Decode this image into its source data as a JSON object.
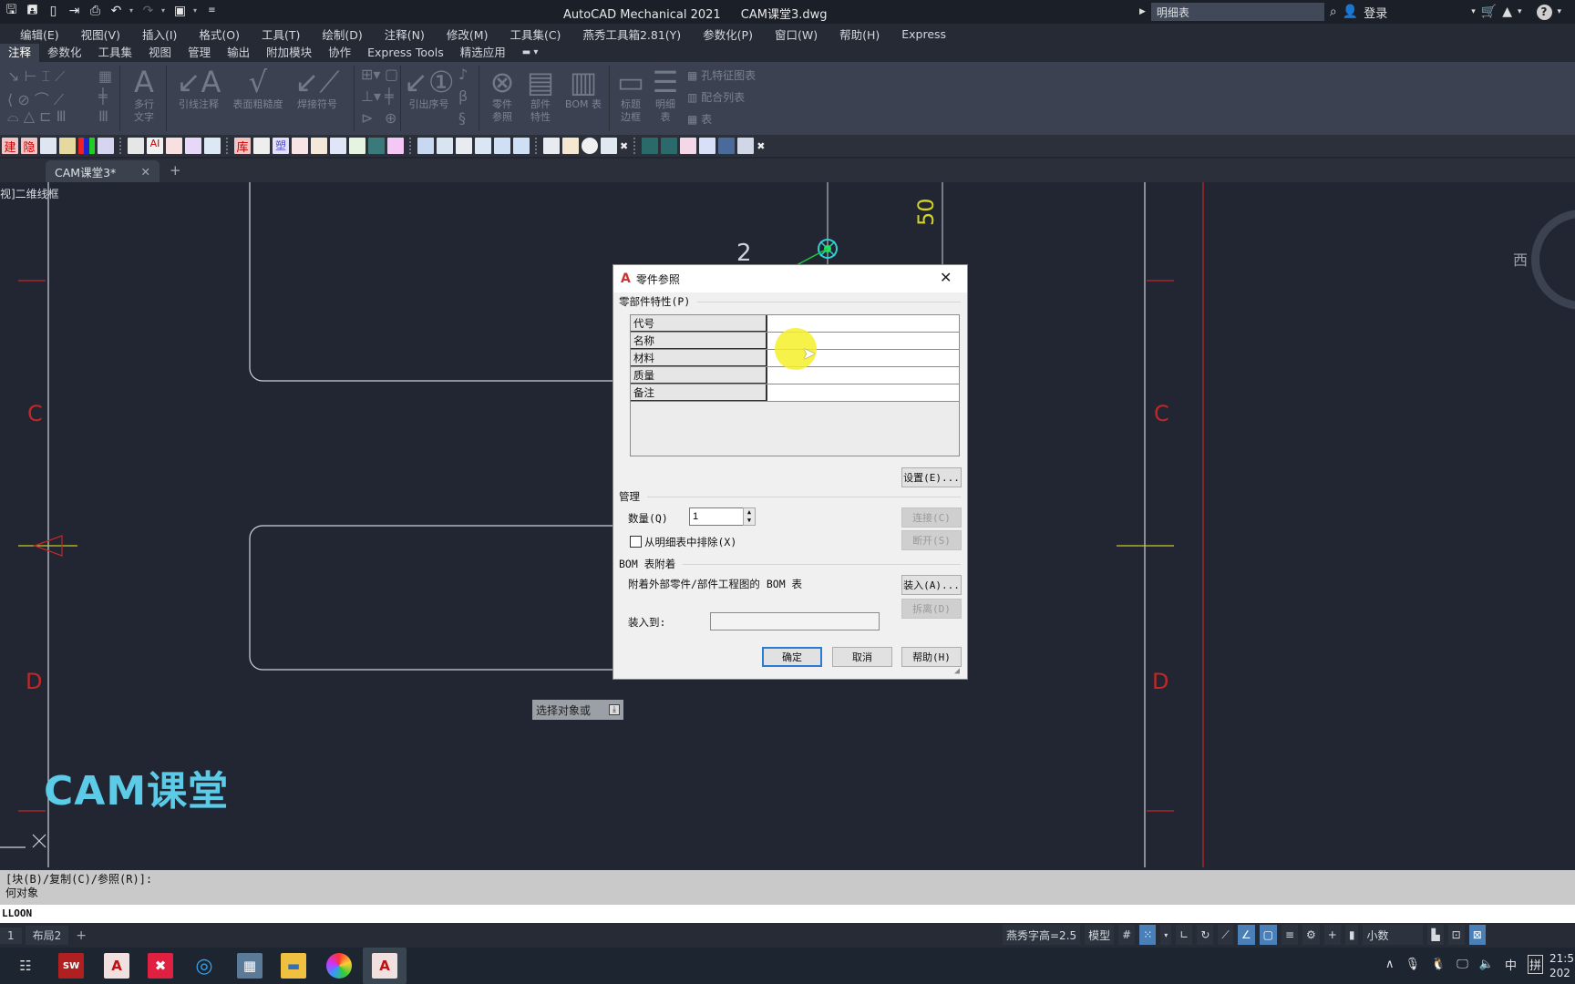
{
  "titlebar": {
    "app_name": "AutoCAD Mechanical 2021",
    "file_name": "CAM课堂3.dwg",
    "search_value": "明细表",
    "login_label": "登录"
  },
  "quick_access": [
    "save-icon",
    "save-as-icon",
    "open-icon",
    "export-icon",
    "print-icon",
    "undo-icon",
    "redo-icon",
    "workspace-icon",
    "customize-icon"
  ],
  "menubar": [
    "编辑(E)",
    "视图(V)",
    "插入(I)",
    "格式(O)",
    "工具(T)",
    "绘制(D)",
    "注释(N)",
    "修改(M)",
    "工具集(C)",
    "燕秀工具箱2.81(Y)",
    "参数化(P)",
    "窗口(W)",
    "帮助(H)",
    "Express"
  ],
  "ribbon_tabs": [
    "注释",
    "参数化",
    "工具集",
    "视图",
    "管理",
    "输出",
    "附加模块",
    "协作",
    "Express Tools",
    "精选应用"
  ],
  "ribbon": {
    "multiline_text": "多行\n文字",
    "leader_note": "引线注释",
    "surface_roughness": "表面粗糙度",
    "weld_symbol": "焊接符号",
    "balloon": "引出序号",
    "part_reference": "零件\n参照",
    "part_properties": "部件\n特性",
    "bom_table": "BOM 表",
    "title_border": "标题\n边框",
    "parts_list": "明细\n表",
    "hole_chart": "孔特征图表",
    "fits_list": "配合列表",
    "table": "表"
  },
  "doc_tab": {
    "label": "CAM课堂3*"
  },
  "canvas": {
    "view_label": "视]二维线框",
    "watermark": "CAM课堂",
    "dim_text": "50",
    "balloon_text": "2",
    "border_letters": [
      "C",
      "C",
      "D",
      "D"
    ],
    "prompt_tooltip": "选择对象或",
    "viewcube_west": "西"
  },
  "dialog": {
    "title": "零件参照",
    "props_group": "零部件特性(P)",
    "props": [
      {
        "key": "代号",
        "value": ""
      },
      {
        "key": "名称",
        "value": ""
      },
      {
        "key": "材料",
        "value": ""
      },
      {
        "key": "质量",
        "value": ""
      },
      {
        "key": "备注",
        "value": ""
      }
    ],
    "settings_btn": "设置(E)...",
    "manage_group": "管理",
    "qty_label": "数量(Q)",
    "qty_value": "1",
    "connect_btn": "连接(C)",
    "disconnect_btn": "断开(S)",
    "exclude_label": "从明细表中排除(X)",
    "exclude_checked": false,
    "bom_group": "BOM 表附着",
    "bom_desc": "附着外部零件/部件工程图的 BOM 表",
    "load_btn": "装入(A)...",
    "detach_btn": "拆离(D)",
    "load_into_label": "装入到:",
    "load_into_value": "",
    "ok_btn": "确定",
    "cancel_btn": "取消",
    "help_btn": "帮助(H)"
  },
  "commandline": {
    "history1": "[块(B)/复制(C)/参照(R)]:",
    "history2": "何对象",
    "input": "LLOON"
  },
  "layout_tabs": [
    "1",
    "布局2"
  ],
  "statusbar": {
    "text_height": "燕秀字高=2.5",
    "model": "模型",
    "units": "小数"
  },
  "taskbar": {
    "apps": [
      "task-view",
      "solidworks-2021",
      "autocad",
      "xmind",
      "browser",
      "calculator",
      "file-explorer",
      "color-app",
      "autocad-mechanical"
    ],
    "tray_ime": "中",
    "tray_pinyin": "拼",
    "clock_time": "21:5",
    "clock_date": "202"
  }
}
